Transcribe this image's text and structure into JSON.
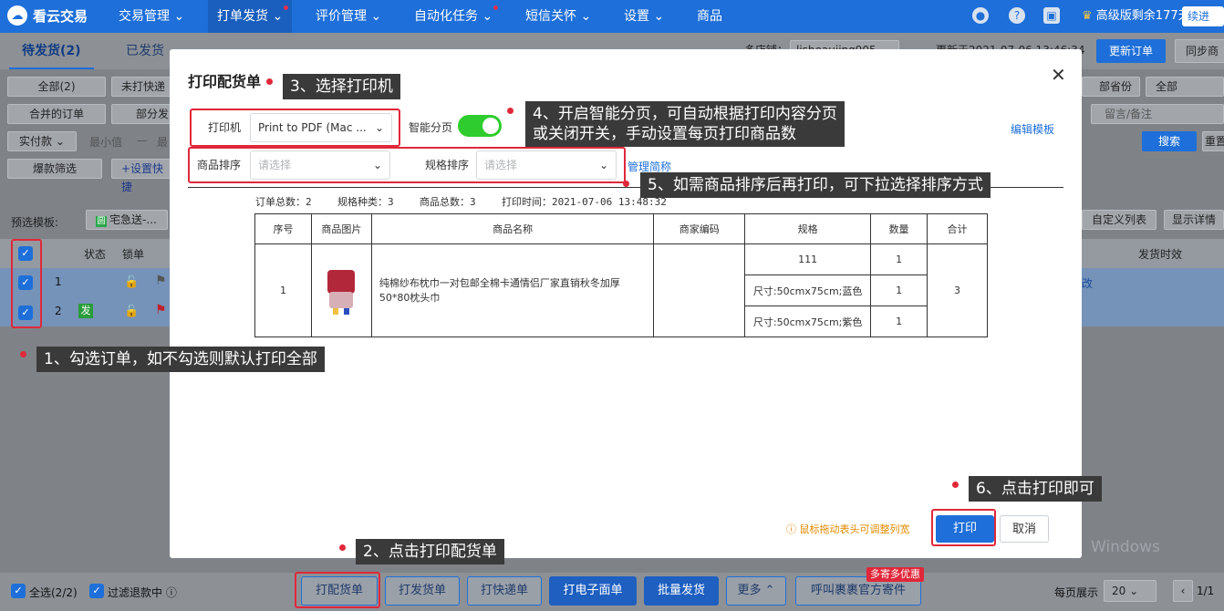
{
  "nav": {
    "logo": "看云交易",
    "items": [
      "交易管理",
      "打单发货",
      "评价管理",
      "自动化任务",
      "短信关怀",
      "设置",
      "商品"
    ],
    "vip": "高级版剩余177天",
    "renew": "续进"
  },
  "bg": {
    "tab_pending": "待发货(2)",
    "tab_shipped": "已发货",
    "shop_label": "多店铺：",
    "shop_value": "lisheaujing905",
    "updated": "更新于2021-07-06 13:46:34",
    "update_btn": "更新订单",
    "sync_btn": "同步商",
    "f_all": "全部(2)",
    "f_unprinted": "未打快递",
    "f_merged": "合并的订单",
    "f_partial": "部分发",
    "f_pay": "实付款",
    "f_min": "最小值",
    "f_dash": "—",
    "f_max": "最",
    "f_burst": "爆款筛选",
    "f_quick": "+设置快捷",
    "province": "部省份",
    "all2": "全部",
    "memo": "留言/备注",
    "search": "搜索",
    "reset": "重置",
    "preset_label": "预选模板:",
    "preset_value": "宅急送-...",
    "custom_cols": "自定义列表",
    "show_detail": "显示详情",
    "col_status": "状态",
    "col_lock": "锁单",
    "col_ship_time": "发货时效",
    "row1_no": "1",
    "row2_no": "2",
    "row2_badge": "发",
    "row1_tail": "改",
    "watermark": "Windows"
  },
  "modal": {
    "title": "打印配货单",
    "printer_label": "打印机",
    "printer_value": "Print to PDF (Mac ...",
    "smart_page": "智能分页",
    "edit_template": "编辑模板",
    "sort_label": "商品排序",
    "sort_placeholder": "请选择",
    "spec_sort_label": "规格排序",
    "spec_sort_placeholder": "请选择",
    "manage_short": "管理简称",
    "summary": {
      "orders": "订单总数：2",
      "specs": "规格种类：3",
      "goods": "商品总数：3",
      "time": "打印时间：2021-07-06 13:48:32"
    },
    "table": {
      "headers": [
        "序号",
        "商品图片",
        "商品名称",
        "商家编码",
        "规格",
        "数量",
        "合计"
      ],
      "seq": "1",
      "name": "纯棉纱布枕巾一对包邮全棉卡通情侣厂家直销秋冬加厚50*80枕头巾",
      "code": "",
      "specs": [
        {
          "spec": "111",
          "qty": "1"
        },
        {
          "spec": "尺寸:50cmx75cm;蓝色",
          "qty": "1"
        },
        {
          "spec": "尺寸:50cmx75cm;紫色",
          "qty": "1"
        }
      ],
      "total": "3"
    },
    "hint": "鼠标拖动表头可调整列宽",
    "print": "打印",
    "cancel": "取消"
  },
  "callouts": {
    "c1": "1、勾选订单，如不勾选则默认打印全部",
    "c2": "2、点击打印配货单",
    "c3": "3、选择打印机",
    "c4a": "4、开启智能分页，可自动根据打印内容分页",
    "c4b": "或关闭开关，手动设置每页打印商品数",
    "c5": "5、如需商品排序后再打印，可下拉选择排序方式",
    "c6": "6、点击打印即可"
  },
  "bottom": {
    "select_all": "全选(2/2)",
    "filter_refund": "过滤退款中",
    "print_pick": "打配货单",
    "print_ship": "打发货单",
    "print_express": "打快递单",
    "print_eface": "打电子面单",
    "batch_ship": "批量发货",
    "more": "更多",
    "call_courier": "呼叫裹裹官方寄件",
    "promo": "多寄多优惠",
    "per_page_label": "每页展示",
    "per_page_value": "20",
    "page": "1/1"
  },
  "colors": {
    "brand": "#1e6fd9",
    "annotation": "#e0283a",
    "toggle_on": "#2ecc2e",
    "hint": "#e08a00"
  }
}
